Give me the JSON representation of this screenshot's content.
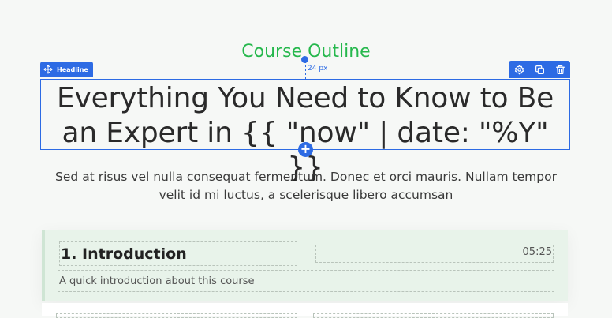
{
  "section": {
    "subtitle": "Course Outline",
    "headline": "Everything You Need to Know to Be an Expert in {{ \"now\" | date: \"%Y\" }}",
    "description": "Sed at risus vel nulla consequat fermentum. Donec et orci mauris. Nullam tempor velit id mi luctus, a scelerisque libero accumsan"
  },
  "editor": {
    "element_tag": "Headline",
    "spacing_label": "24 px",
    "accent_color": "#2d6be4",
    "toolbar_icons": [
      "settings-icon",
      "duplicate-icon",
      "delete-icon"
    ],
    "add_button": "+"
  },
  "lessons": [
    {
      "title": "1. Introduction",
      "duration": "05:25",
      "description": "A quick introduction about this course"
    }
  ],
  "colors": {
    "subtitle": "#26b84d",
    "card_background": "#e8f3ea"
  }
}
